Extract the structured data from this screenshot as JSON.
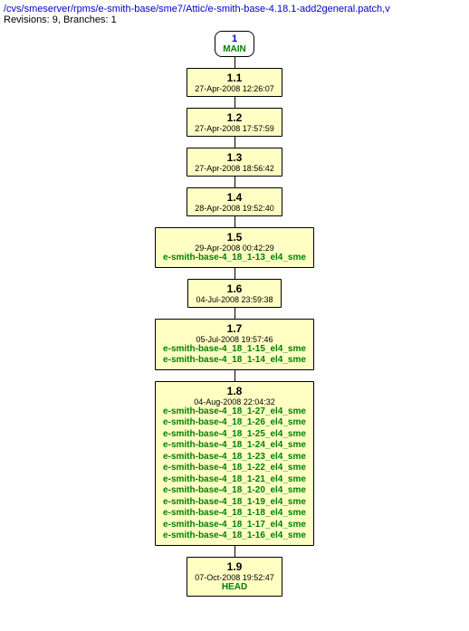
{
  "header": {
    "path": "/cvs/smeserver/rpms/e-smith-base/sme7/Attic/e-smith-base-4.18.1-add2general.patch,v",
    "info": "Revisions: 9, Branches: 1"
  },
  "main_node": {
    "number": "1",
    "label": "MAIN"
  },
  "revisions": [
    {
      "rev": "1.1",
      "date": "27-Apr-2008 12:26:07",
      "tags": []
    },
    {
      "rev": "1.2",
      "date": "27-Apr-2008 17:57:59",
      "tags": []
    },
    {
      "rev": "1.3",
      "date": "27-Apr-2008 18:56:42",
      "tags": []
    },
    {
      "rev": "1.4",
      "date": "28-Apr-2008 19:52:40",
      "tags": []
    },
    {
      "rev": "1.5",
      "date": "29-Apr-2008 00:42:29",
      "tags": [
        "e-smith-base-4_18_1-13_el4_sme"
      ]
    },
    {
      "rev": "1.6",
      "date": "04-Jul-2008 23:59:38",
      "tags": []
    },
    {
      "rev": "1.7",
      "date": "05-Jul-2008 19:57:46",
      "tags": [
        "e-smith-base-4_18_1-15_el4_sme",
        "e-smith-base-4_18_1-14_el4_sme"
      ]
    },
    {
      "rev": "1.8",
      "date": "04-Aug-2008 22:04:32",
      "tags": [
        "e-smith-base-4_18_1-27_el4_sme",
        "e-smith-base-4_18_1-26_el4_sme",
        "e-smith-base-4_18_1-25_el4_sme",
        "e-smith-base-4_18_1-24_el4_sme",
        "e-smith-base-4_18_1-23_el4_sme",
        "e-smith-base-4_18_1-22_el4_sme",
        "e-smith-base-4_18_1-21_el4_sme",
        "e-smith-base-4_18_1-20_el4_sme",
        "e-smith-base-4_18_1-19_el4_sme",
        "e-smith-base-4_18_1-18_el4_sme",
        "e-smith-base-4_18_1-17_el4_sme",
        "e-smith-base-4_18_1-16_el4_sme"
      ]
    },
    {
      "rev": "1.9",
      "date": "07-Oct-2008 19:52:47",
      "tags": [
        "HEAD"
      ]
    }
  ]
}
